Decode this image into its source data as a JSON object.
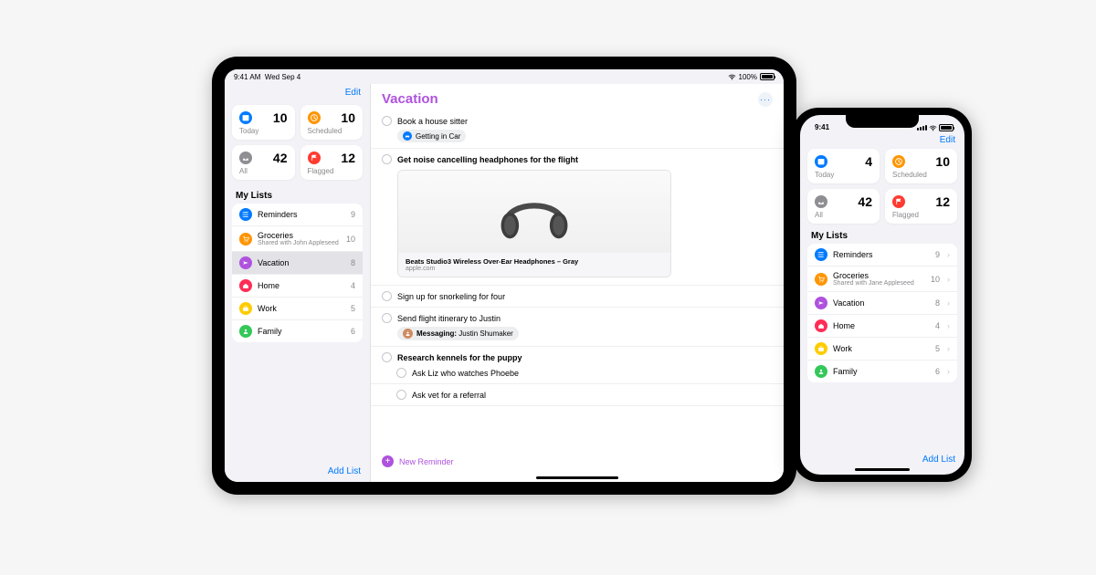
{
  "ipad": {
    "status": {
      "time": "9:41 AM",
      "date": "Wed Sep 4",
      "wifi_label": "wifi",
      "battery_pct": "100%"
    },
    "edit_label": "Edit",
    "cards": [
      {
        "label": "Today",
        "count": "10",
        "color": "blue",
        "icon": "calendar"
      },
      {
        "label": "Scheduled",
        "count": "10",
        "color": "orange",
        "icon": "clock"
      },
      {
        "label": "All",
        "count": "42",
        "color": "gray",
        "icon": "tray"
      },
      {
        "label": "Flagged",
        "count": "12",
        "color": "red",
        "icon": "flag"
      }
    ],
    "my_lists_title": "My Lists",
    "lists": [
      {
        "name": "Reminders",
        "count": "9",
        "color": "blue",
        "icon": "list"
      },
      {
        "name": "Groceries",
        "sub": "Shared with John Appleseed",
        "count": "10",
        "color": "orange",
        "icon": "cart"
      },
      {
        "name": "Vacation",
        "count": "8",
        "color": "purple",
        "icon": "plane",
        "selected": true
      },
      {
        "name": "Home",
        "count": "4",
        "color": "pink",
        "icon": "house"
      },
      {
        "name": "Work",
        "count": "5",
        "color": "yellow",
        "icon": "briefcase"
      },
      {
        "name": "Family",
        "count": "6",
        "color": "green",
        "icon": "person"
      }
    ],
    "add_list_label": "Add List",
    "detail": {
      "title": "Vacation",
      "more_label": "···",
      "reminders": {
        "r0": {
          "title": "Book a house sitter",
          "chip_label": "Getting in Car",
          "chip_color": "blue"
        },
        "r1": {
          "title": "Get noise cancelling headphones for the flight",
          "link_title": "Beats Studio3 Wireless Over-Ear Headphones – Gray",
          "link_domain": "apple.com"
        },
        "r2": {
          "title": "Sign up for snorkeling for four"
        },
        "r3": {
          "title": "Send flight itinerary to Justin",
          "chip_prefix": "Messaging:",
          "chip_name": "Justin Shumaker"
        },
        "r4": {
          "title": "Research kennels for the puppy",
          "subs": [
            {
              "title": "Ask Liz who watches Phoebe"
            },
            {
              "title": "Ask vet for a referral"
            }
          ]
        }
      },
      "new_reminder_label": "New Reminder"
    }
  },
  "iphone": {
    "status": {
      "time": "9:41"
    },
    "edit_label": "Edit",
    "cards": [
      {
        "label": "Today",
        "count": "4",
        "color": "blue",
        "icon": "calendar"
      },
      {
        "label": "Scheduled",
        "count": "10",
        "color": "orange",
        "icon": "clock"
      },
      {
        "label": "All",
        "count": "42",
        "color": "gray",
        "icon": "tray"
      },
      {
        "label": "Flagged",
        "count": "12",
        "color": "red",
        "icon": "flag"
      }
    ],
    "my_lists_title": "My Lists",
    "lists": [
      {
        "name": "Reminders",
        "count": "9",
        "color": "blue",
        "icon": "list"
      },
      {
        "name": "Groceries",
        "sub": "Shared with Jane Appleseed",
        "count": "10",
        "color": "orange",
        "icon": "cart"
      },
      {
        "name": "Vacation",
        "count": "8",
        "color": "purple",
        "icon": "plane"
      },
      {
        "name": "Home",
        "count": "4",
        "color": "pink",
        "icon": "house"
      },
      {
        "name": "Work",
        "count": "5",
        "color": "yellow",
        "icon": "briefcase"
      },
      {
        "name": "Family",
        "count": "6",
        "color": "green",
        "icon": "person"
      }
    ],
    "add_list_label": "Add List"
  }
}
